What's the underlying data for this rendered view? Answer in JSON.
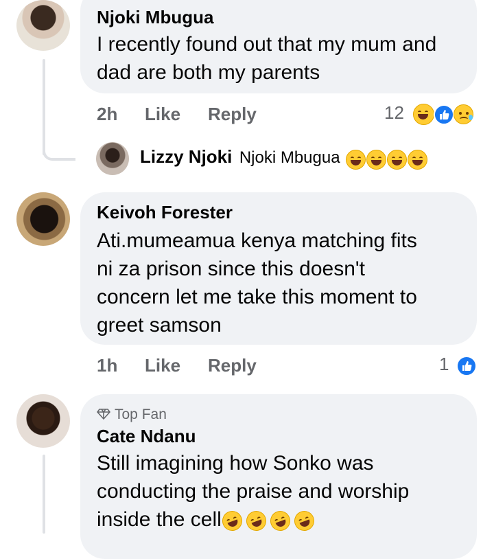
{
  "comments": [
    {
      "author": "Njoki Mbugua",
      "text_lines": [
        "I recently found out that my mum and",
        "dad are both my parents"
      ],
      "time": "2h",
      "like_label": "Like",
      "reply_label": "Reply",
      "reaction_count": "12",
      "reactions": [
        "laugh-icon",
        "like-icon",
        "sad-icon"
      ]
    },
    {
      "author": "Keivoh Forester",
      "text_lines": [
        "Ati.mumeamua kenya matching fits",
        "ni za prison since this doesn't",
        "concern let me take this moment to",
        "greet samson"
      ],
      "time": "1h",
      "like_label": "Like",
      "reply_label": "Reply",
      "reaction_count": "1",
      "reactions": [
        "like-icon"
      ]
    },
    {
      "badge": "Top Fan",
      "author": "Cate Ndanu",
      "text_lines": [
        "Still imagining how Sonko was",
        "conducting the praise and worship",
        "inside the cell"
      ]
    }
  ],
  "reply_preview": {
    "author": "Lizzy Njoki",
    "text": "Njoki Mbugua"
  },
  "colors": {
    "bubble": "#f0f2f5",
    "meta": "#65676b",
    "like_blue": "#1877f2",
    "emoji_yellow": "#ffcc33"
  }
}
